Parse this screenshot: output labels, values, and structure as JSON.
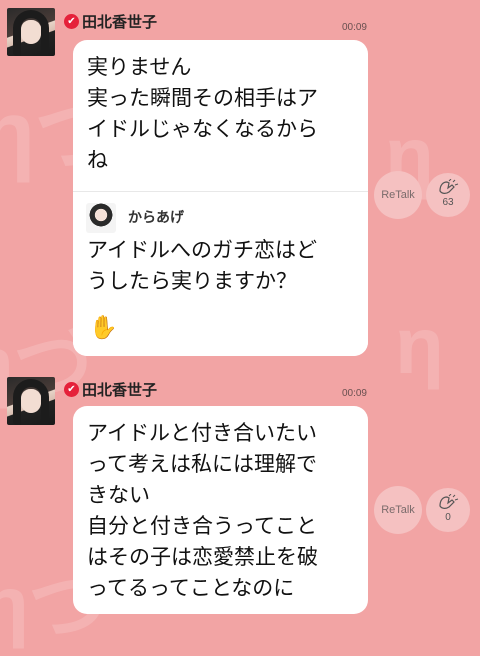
{
  "posts": [
    {
      "author": "田北香世子",
      "time": "00:09",
      "verified_icon": "✔",
      "message": "実りません\n実った瞬間その相手はア\nイドルじゃなくなるから\nね",
      "quote": {
        "author": "からあげ",
        "text": "アイドルへのガチ恋はど\nうしたら実りますか？",
        "hand_icon": "✋"
      },
      "retalk_label": "ReTalk",
      "clap_count": "63"
    },
    {
      "author": "田北香世子",
      "time": "00:09",
      "verified_icon": "✔",
      "message": "アイドルと付き合いたい\nって考えは私には理解で\nきない\n自分と付き合うってこと\nはその子は恋愛禁止を破\nってるってことなのに",
      "retalk_label": "ReTalk",
      "clap_count": "0"
    }
  ],
  "colors": {
    "background": "#f2a4a4",
    "bubble": "#ffffff",
    "verified": "#e5213a",
    "action_circle": "#f5c1c1"
  }
}
